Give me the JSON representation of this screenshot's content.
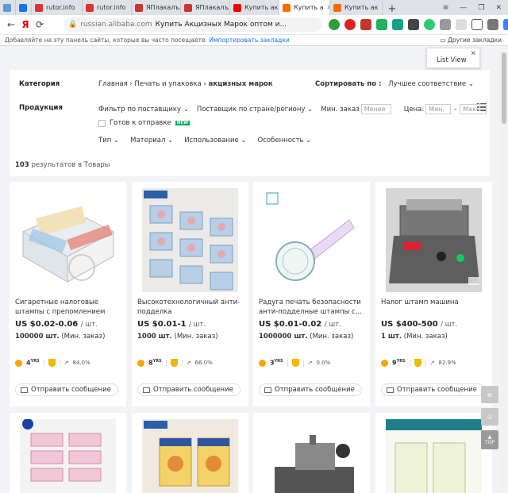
{
  "browser": {
    "tabs": [
      {
        "label": "",
        "color": "#5a9bd8",
        "active": false
      },
      {
        "label": "",
        "color": "#1a73e8",
        "active": false
      },
      {
        "label": "rutor.info",
        "color": "#d33",
        "active": false
      },
      {
        "label": "rutor.info",
        "color": "#d33",
        "active": false
      },
      {
        "label": "ЯПлакалъ",
        "color": "#c33",
        "active": false
      },
      {
        "label": "ЯПлакалъ",
        "color": "#c33",
        "active": false
      },
      {
        "label": "Купить ак",
        "color": "#e00",
        "active": false
      },
      {
        "label": "Купить а",
        "color": "#ff6a00",
        "active": true
      },
      {
        "label": "Купить ак",
        "color": "#ff6a00",
        "active": false
      }
    ],
    "new_tab": "+",
    "url_host": "russian.alibaba.com",
    "url_title": "Купить Акцизных Марок оптом и...",
    "bookmarks_hint": "Добавляйте на эту панель сайты, которые вы часто посещаете.",
    "bookmarks_import": "Импортировать закладки",
    "other_bookmarks": "Другие закладки"
  },
  "filters": {
    "category_label": "Категория",
    "breadcrumbs": [
      "Главная",
      "Печать и упаковка",
      "акцизных марок"
    ],
    "sort_label": "Сортировать по :",
    "sort_value": "Лучшее соответствие",
    "product_label": "Продукция",
    "by_supplier": "Фильтр по поставщику",
    "supplier_region": "Поставщик по стране/региону",
    "min_order_label": "Мин. заказ",
    "min_order_placeholder": "Менее",
    "price_label": "Цена:",
    "price_min": "Мин.",
    "price_max": "Макс.",
    "ready_to_ship": "Готов к отправке",
    "new_badge": "NEW",
    "attrs": [
      "Тип",
      "Материал",
      "Использование",
      "Особенность"
    ]
  },
  "list_view_tip": "List View",
  "results": {
    "count": "103",
    "text": "результатов в Товары"
  },
  "products": [
    {
      "title": "Сигаретные налоговые штампы с препомлением перламутровый...",
      "price": "US $0.02-0.06",
      "unit": "/ шт.",
      "moq": "100000 шт.",
      "moq_suffix": "(Мин. заказ)",
      "years": "4",
      "rate": "84.0%",
      "button": "Отправить сообщение"
    },
    {
      "title": "Высокотехнологичный анти-подделка пользовательский...",
      "price": "US $0.01-1",
      "unit": "/ шт.",
      "moq": "1000 шт.",
      "moq_suffix": "(Мин. заказ)",
      "years": "8",
      "rate": "66.0%",
      "button": "Отправить сообщение"
    },
    {
      "title": "Радуга печать безопасности анти-подделные штампы с...",
      "price": "US $0.01-0.02",
      "unit": "/ шт.",
      "moq": "1000000 шт.",
      "moq_suffix": "(Мин. заказ)",
      "years": "3",
      "rate": "0.0%",
      "button": "Отправить сообщение"
    },
    {
      "title": "Налог штамп машина",
      "price": "US $400-500",
      "unit": "/ шт.",
      "moq": "1 шт.",
      "moq_suffix": "(Мин. заказ)",
      "years": "9",
      "rate": "82.9%",
      "button": "Отправить сообщение"
    }
  ],
  "side_tools": {
    "top": "TOP"
  },
  "yrs_label": "YRS"
}
